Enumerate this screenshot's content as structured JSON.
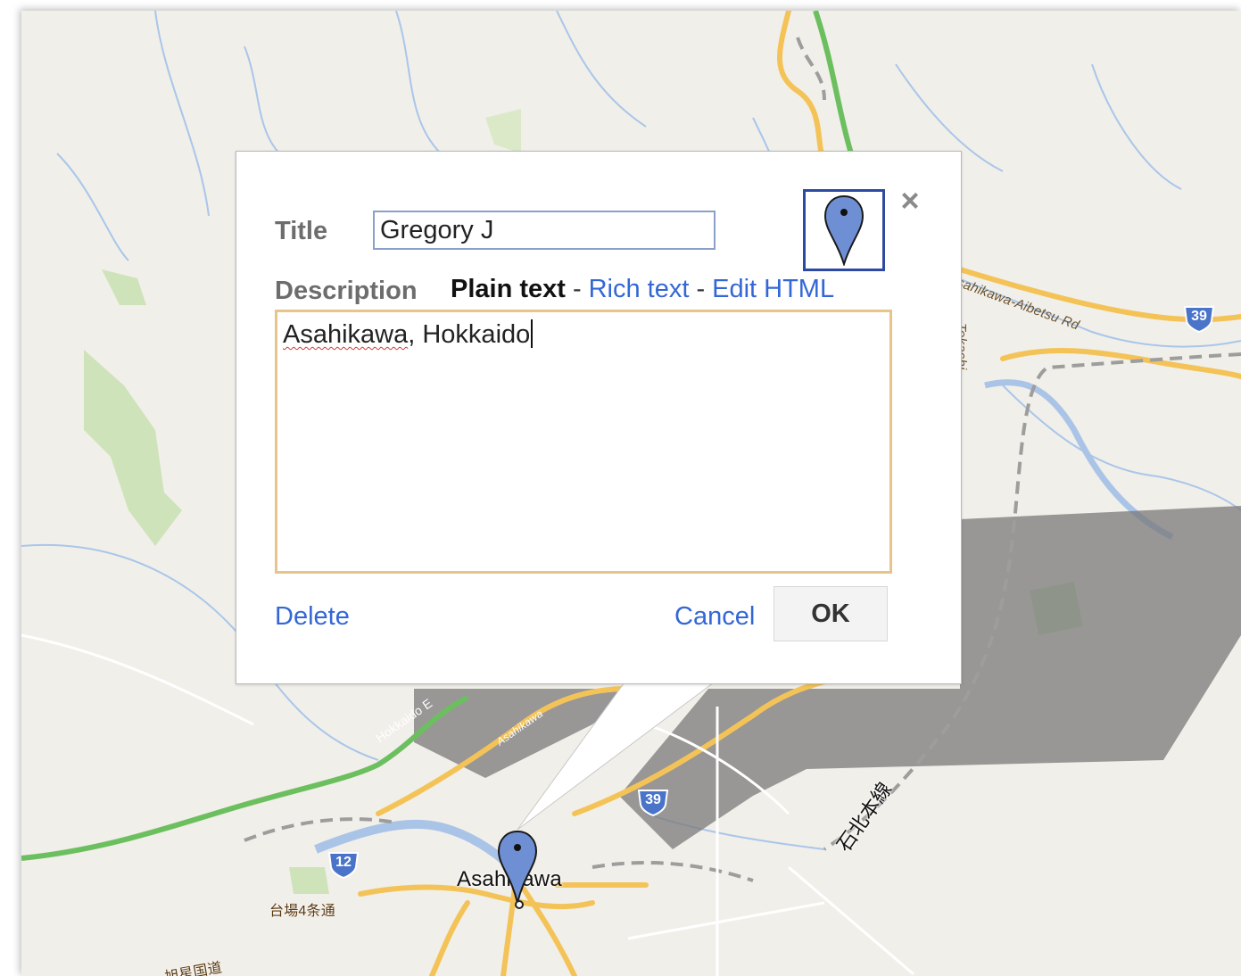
{
  "dialog": {
    "title_label": "Title",
    "title_value": "Gregory J",
    "description_label": "Description",
    "format_plain": "Plain text",
    "format_sep1": "-",
    "format_rich": "Rich text",
    "format_sep2": "-",
    "format_html": "Edit HTML",
    "description_word1": "Asahikawa",
    "description_rest": ", Hokkaido",
    "delete_label": "Delete",
    "cancel_label": "Cancel",
    "ok_label": "OK",
    "close_glyph": "×",
    "marker_icon": "blue-pin-icon"
  },
  "map": {
    "city_label": "Asahikawa",
    "road_labels": {
      "hokkaido_expwy": "Hokkaido E",
      "asahikawa_rd": "Asahikawa",
      "aibetsu_rd": "sahikawa-Aibetsu Rd",
      "tokachi_rd": "Tokachi"
    },
    "rail_label": "石北本線",
    "street_label": "台場4条通",
    "bottom_label": "旭星国道",
    "shields": [
      {
        "route": "39",
        "color": "#4a74c9"
      },
      {
        "route": "39",
        "color": "#4a74c9"
      },
      {
        "route": "12",
        "color": "#4a74c9"
      }
    ],
    "colors": {
      "land": "#f1efe9",
      "road_major": "#f6c55c",
      "expressway": "#7bc96b",
      "park": "#c9e2b3",
      "water": "#aac4e8",
      "rail": "#a7a7a7"
    }
  }
}
